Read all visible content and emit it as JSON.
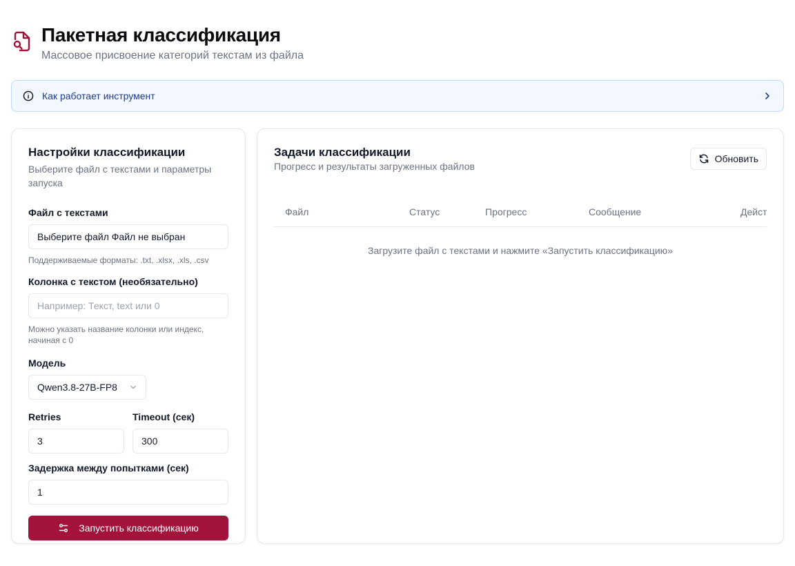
{
  "header": {
    "title": "Пакетная классификация",
    "subtitle": "Массовое присвоение категорий текстам из файла"
  },
  "info": {
    "label": "Как работает инструмент"
  },
  "settings": {
    "title": "Настройки классификации",
    "description": "Выберите файл с текстами и параметры запуска",
    "file": {
      "label": "Файл с текстами",
      "value": "Выберите файл Файл не выбран",
      "hint": "Поддерживаемые форматы: .txt, .xlsx, .xls, .csv"
    },
    "column": {
      "label": "Колонка с текстом (необязательно)",
      "placeholder": "Например: Текст, text или 0",
      "hint": "Можно указать название колонки или индекс, начиная с 0"
    },
    "model": {
      "label": "Модель",
      "value": "Qwen3.8-27B-FP8"
    },
    "retries": {
      "label": "Retries",
      "value": "3"
    },
    "timeout": {
      "label": "Timeout (сек)",
      "value": "300"
    },
    "delay": {
      "label": "Задержка между попытками (сек)",
      "value": "1"
    },
    "run_label": "Запустить классификацию"
  },
  "tasks": {
    "title": "Задачи классификации",
    "description": "Прогресс и результаты загруженных файлов",
    "refresh_label": "Обновить",
    "columns": [
      "Файл",
      "Статус",
      "Прогресс",
      "Сообщение",
      "Действия"
    ],
    "empty": "Загрузите файл с текстами и нажмите «Запустить классификацию»"
  },
  "colors": {
    "accent": "#a3123a",
    "info_border": "#bfdbfe",
    "info_bg": "#f3f8ff"
  }
}
